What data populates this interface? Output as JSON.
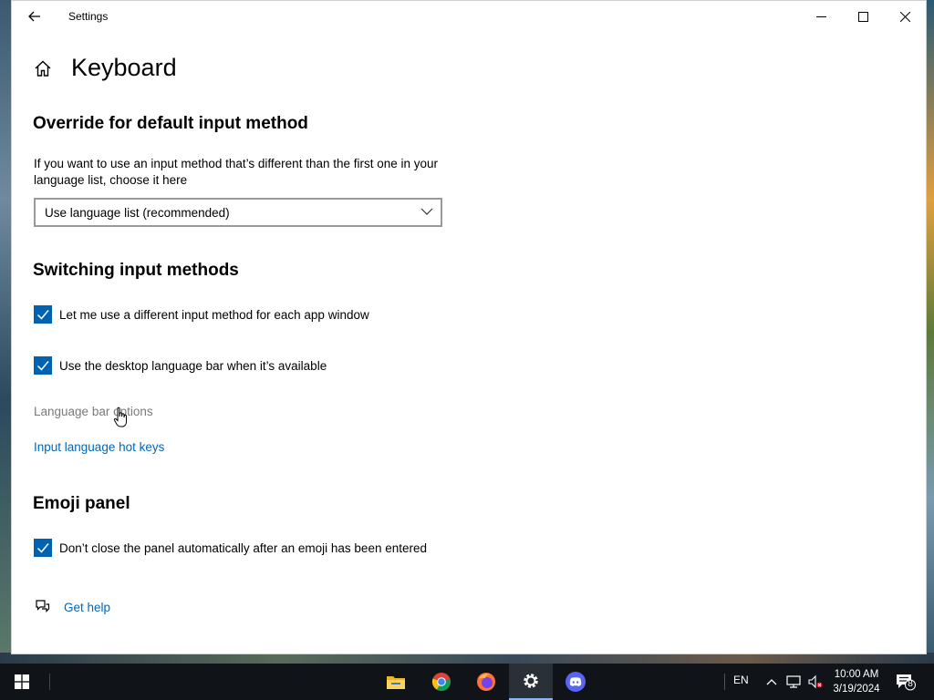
{
  "window": {
    "title": "Settings"
  },
  "page": {
    "title": "Keyboard"
  },
  "override": {
    "heading": "Override for default input method",
    "description": "If you want to use an input method that’s different than the first one in your language list, choose it here",
    "dropdown_value": "Use language list (recommended)"
  },
  "switching": {
    "heading": "Switching input methods",
    "checkbox_per_app": {
      "label": "Let me use a different input method for each app window",
      "checked": true
    },
    "checkbox_langbar": {
      "label": "Use the desktop language bar when it’s available",
      "checked": true
    },
    "language_bar_options": "Language bar options",
    "hotkeys_link": "Input language hot keys"
  },
  "emoji": {
    "heading": "Emoji panel",
    "checkbox_keep_open": {
      "label": "Don’t close the panel automatically after an emoji has been entered",
      "checked": true
    }
  },
  "help": {
    "label": "Get help"
  },
  "taskbar": {
    "apps": [
      "file-explorer-icon",
      "chrome-icon",
      "firefox-icon",
      "settings-icon",
      "discord-icon"
    ],
    "active_app": "settings-icon",
    "language": "EN",
    "time": "10:00 AM",
    "date": "3/19/2024",
    "notification_count": "8"
  },
  "colors": {
    "accent": "#0063b1",
    "link": "#0067b8",
    "disabled": "#7a7a7a",
    "taskbar": "#101419"
  }
}
